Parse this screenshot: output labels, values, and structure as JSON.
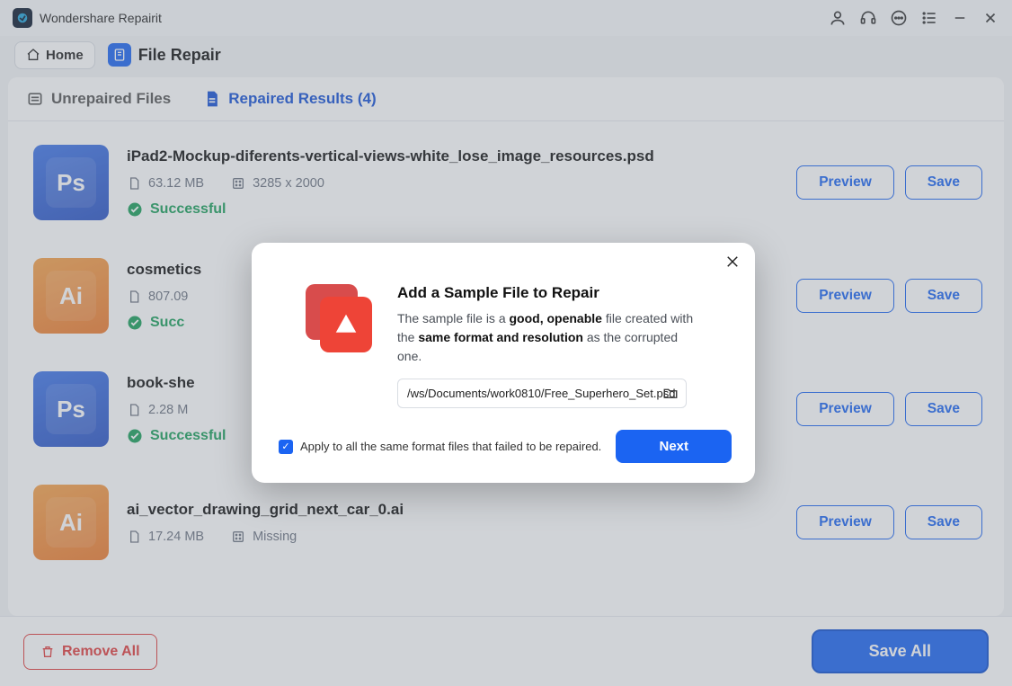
{
  "app": {
    "name": "Wondershare Repairit"
  },
  "breadcrumb": {
    "home": "Home",
    "section": "File Repair"
  },
  "tabs": {
    "unrepaired": "Unrepaired Files",
    "repaired": "Repaired Results (4)"
  },
  "buttons": {
    "preview": "Preview",
    "save": "Save",
    "remove_all": "Remove All",
    "save_all": "Save All"
  },
  "status": {
    "successful": "Successful"
  },
  "files": [
    {
      "name": "iPad2-Mockup-diferents-vertical-views-white_lose_image_resources.psd",
      "size": "63.12 MB",
      "dims": "3285 x 2000",
      "type": "ps",
      "status": "Successful"
    },
    {
      "name": "cosmetics",
      "size": "807.09",
      "dims": "",
      "type": "ai",
      "status": "Succ"
    },
    {
      "name": "book-she",
      "size": "2.28 M",
      "dims": "",
      "type": "ps",
      "status": "Successful"
    },
    {
      "name": "ai_vector_drawing_grid_next_car_0.ai",
      "size": "17.24 MB",
      "dims": "Missing",
      "type": "ai",
      "status": ""
    }
  ],
  "modal": {
    "title": "Add a Sample File to Repair",
    "desc_1": "The sample file is a ",
    "desc_b1": "good, openable",
    "desc_2": " file created with the ",
    "desc_b2": "same format and resolution",
    "desc_3": " as the corrupted one.",
    "path": "/ws/Documents/work0810/Free_Superhero_Set.psd",
    "apply_label": "Apply to all the same format files that failed to be repaired.",
    "next": "Next"
  }
}
